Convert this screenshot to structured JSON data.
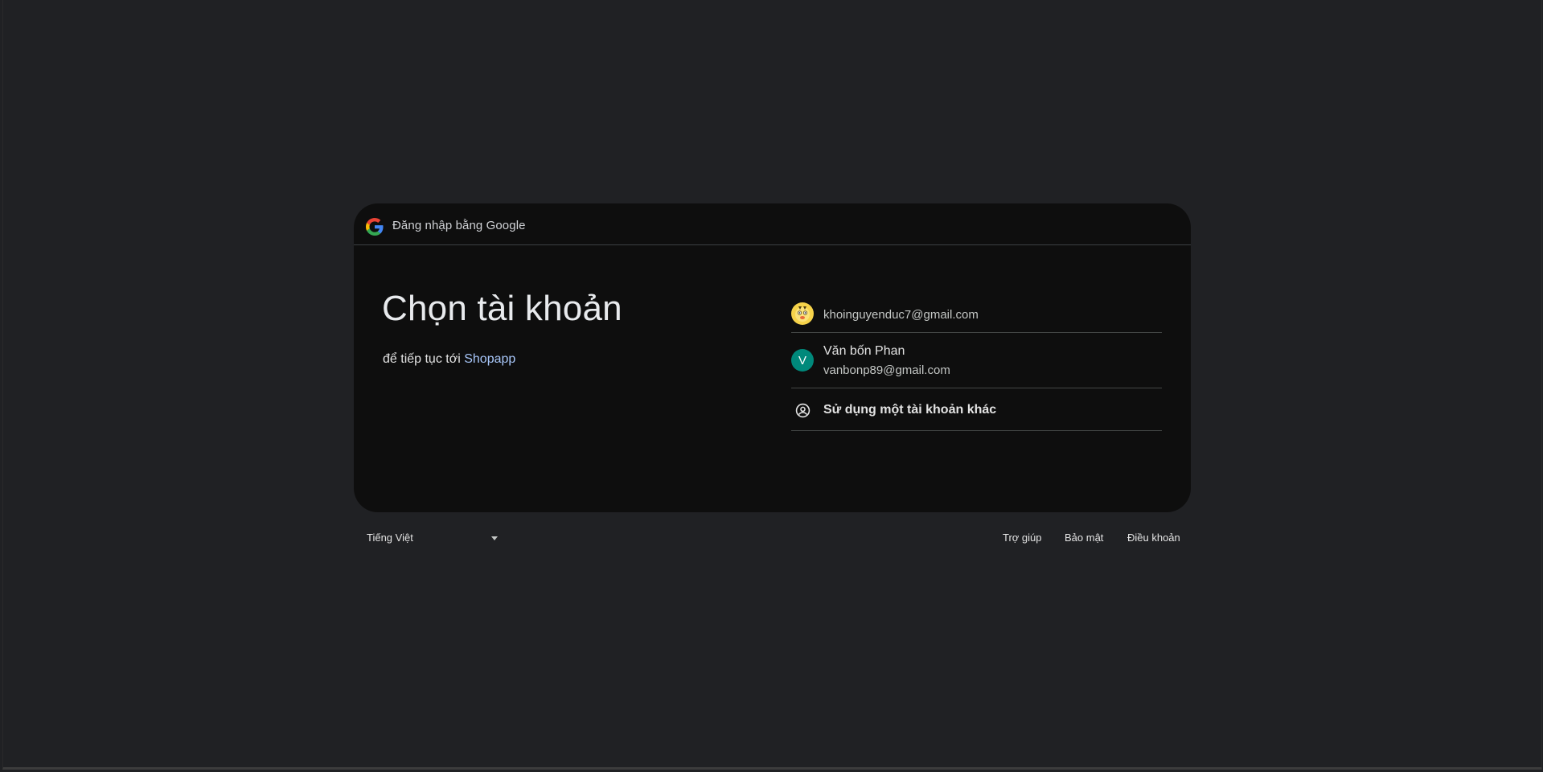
{
  "header": {
    "title": "Đăng nhập bằng Google",
    "logo_icon": "google-g-icon"
  },
  "main": {
    "title": "Chọn tài khoản",
    "subtitle_prefix": "để tiếp tục tới ",
    "app_name": "Shopapp"
  },
  "accounts": [
    {
      "email": "khoinguyenduc7@gmail.com",
      "avatar_icon": "cartoon-avatar-icon"
    },
    {
      "name": "Văn bốn Phan",
      "email": "vanbonp89@gmail.com",
      "avatar_letter": "V",
      "avatar_color": "#00897b"
    }
  ],
  "use_other": {
    "label": "Sử dụng một tài khoản khác",
    "icon": "account-circle-icon"
  },
  "footer": {
    "language": "Tiếng Việt",
    "links": {
      "help": "Trợ giúp",
      "privacy": "Bảo mật",
      "terms": "Điều khoản"
    }
  },
  "colors": {
    "background": "#202124",
    "card": "#0e0e0e",
    "link": "#a8c7fa"
  }
}
